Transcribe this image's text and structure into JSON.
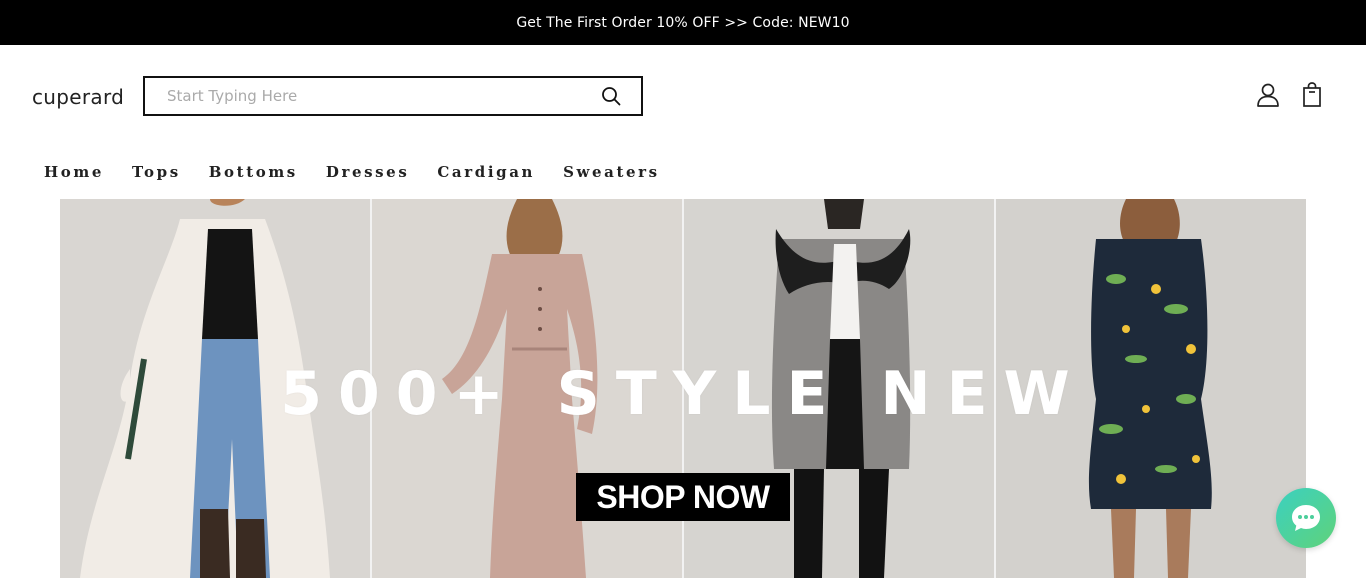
{
  "promo": {
    "text": "Get The First Order 10% OFF >> Code: NEW10"
  },
  "header": {
    "logo": "cuperard",
    "search": {
      "placeholder": "Start Typing Here",
      "value": ""
    },
    "icons": {
      "search": "search-icon",
      "user": "user-icon",
      "cart": "shopping-bag-icon"
    }
  },
  "nav": {
    "items": [
      "Home",
      "Tops",
      "Bottoms",
      "Dresses",
      "Cardigan",
      "Sweaters"
    ]
  },
  "hero": {
    "title": "500+ STYLE NEW",
    "cta": "SHOP NOW"
  },
  "chat": {
    "icon": "chat-bubble-icon",
    "color_start": "#3bd1c0",
    "color_end": "#5fd27a"
  },
  "colors": {
    "promo_bg": "#000000",
    "text": "#222222",
    "cta_bg": "#000000"
  }
}
